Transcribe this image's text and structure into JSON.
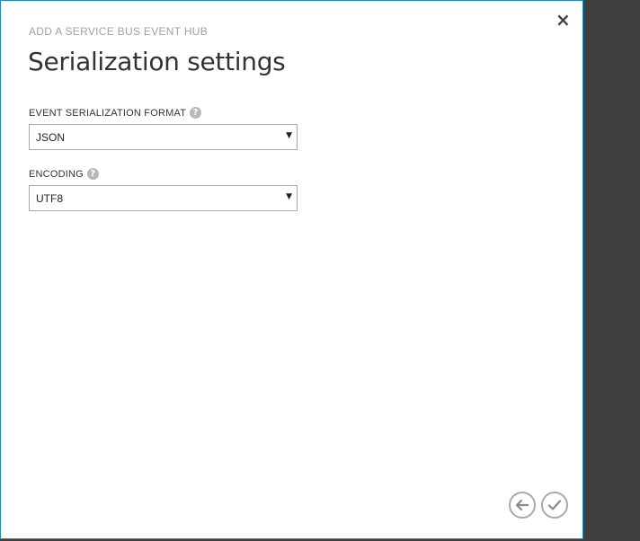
{
  "dialog": {
    "wizard_title": "ADD A SERVICE BUS EVENT HUB",
    "page_title": "Serialization settings",
    "close_label": "×"
  },
  "fields": {
    "format": {
      "label": "EVENT SERIALIZATION FORMAT",
      "value": "JSON"
    },
    "encoding": {
      "label": "ENCODING",
      "value": "UTF8"
    }
  },
  "icons": {
    "help": "?",
    "dropdown": "▼"
  },
  "colors": {
    "accent_border": "#1a8fbf",
    "backdrop": "#3f3f3f"
  }
}
